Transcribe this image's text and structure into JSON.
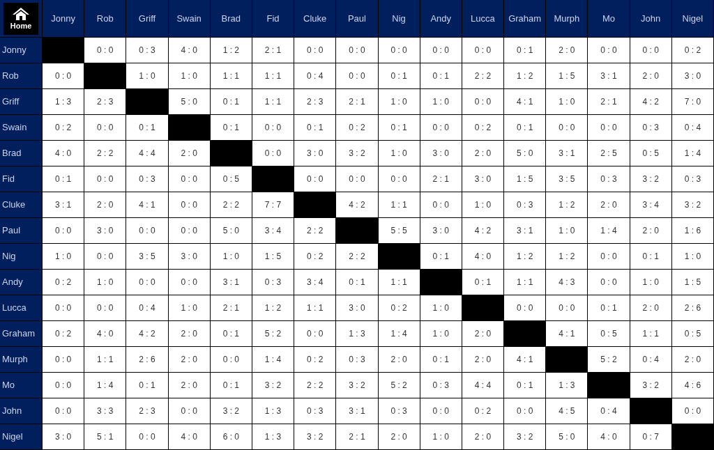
{
  "home_button": {
    "label": "Home"
  },
  "columns": [
    "Jonny",
    "Rob",
    "Griff",
    "Swain",
    "Brad",
    "Fid",
    "Cluke",
    "Paul",
    "Nig",
    "Andy",
    "Lucca",
    "Graham",
    "Murph",
    "Mo",
    "John",
    "Nigel"
  ],
  "rows": [
    {
      "name": "Jonny",
      "cells": [
        null,
        "0 : 0",
        "0 : 3",
        "4 : 0",
        "1 : 2",
        "2 : 1",
        "0 : 0",
        "0 : 0",
        "0 : 0",
        "0 : 0",
        "0 : 0",
        "0 : 1",
        "2 : 0",
        "0 : 0",
        "0 : 0",
        "0 : 2"
      ]
    },
    {
      "name": "Rob",
      "cells": [
        "0 : 0",
        null,
        "1 : 0",
        "1 : 0",
        "1 : 1",
        "1 : 1",
        "0 : 4",
        "0 : 0",
        "0 : 1",
        "0 : 1",
        "2 : 2",
        "1 : 2",
        "1 : 5",
        "3 : 1",
        "2 : 0",
        "3 : 0"
      ]
    },
    {
      "name": "Griff",
      "cells": [
        "1 : 3",
        "2 : 3",
        null,
        "5 : 0",
        "0 : 1",
        "1 : 1",
        "2 : 3",
        "2 : 1",
        "1 : 0",
        "1 : 0",
        "0 : 0",
        "4 : 1",
        "1 : 0",
        "2 : 1",
        "4 : 2",
        "7 : 0"
      ]
    },
    {
      "name": "Swain",
      "cells": [
        "0 : 2",
        "0 : 0",
        "0 : 1",
        null,
        "0 : 1",
        "0 : 0",
        "0 : 1",
        "0 : 2",
        "0 : 1",
        "0 : 0",
        "0 : 2",
        "0 : 1",
        "0 : 0",
        "0 : 0",
        "0 : 3",
        "0 : 4"
      ]
    },
    {
      "name": "Brad",
      "cells": [
        "4 : 0",
        "2 : 2",
        "4 : 4",
        "2 : 0",
        null,
        "0 : 0",
        "3 : 0",
        "3 : 2",
        "1 : 0",
        "3 : 0",
        "2 : 0",
        "5 : 0",
        "3 : 1",
        "2 : 5",
        "0 : 5",
        "1 : 4"
      ]
    },
    {
      "name": "Fid",
      "cells": [
        "0 : 1",
        "0 : 0",
        "0 : 3",
        "0 : 0",
        "0 : 5",
        null,
        "0 : 0",
        "0 : 0",
        "0 : 0",
        "2 : 1",
        "3 : 0",
        "1 : 5",
        "3 : 5",
        "0 : 3",
        "3 : 2",
        "0 : 3"
      ]
    },
    {
      "name": "Cluke",
      "cells": [
        "3 : 1",
        "2 : 0",
        "4 : 1",
        "0 : 0",
        "2 : 2",
        "7 : 7",
        null,
        "4 : 2",
        "1 : 1",
        "0 : 0",
        "1 : 0",
        "0 : 3",
        "1 : 2",
        "2 : 0",
        "3 : 4",
        "3 : 2"
      ]
    },
    {
      "name": "Paul",
      "cells": [
        "0 : 0",
        "3 : 0",
        "0 : 0",
        "0 : 0",
        "5 : 0",
        "3 : 4",
        "2 : 2",
        null,
        "5 : 5",
        "3 : 0",
        "4 : 2",
        "3 : 1",
        "1 : 0",
        "1 : 4",
        "2 : 0",
        "1 : 6"
      ]
    },
    {
      "name": "Nig",
      "cells": [
        "1 : 0",
        "0 : 0",
        "3 : 5",
        "3 : 0",
        "1 : 0",
        "1 : 5",
        "0 : 2",
        "2 : 2",
        null,
        "0 : 1",
        "4 : 0",
        "1 : 2",
        "1 : 2",
        "0 : 0",
        "0 : 1",
        "1 : 0"
      ]
    },
    {
      "name": "Andy",
      "cells": [
        "0 : 2",
        "1 : 0",
        "0 : 0",
        "0 : 0",
        "3 : 1",
        "0 : 3",
        "3 : 4",
        "0 : 1",
        "1 : 1",
        null,
        "0 : 1",
        "1 : 1",
        "4 : 3",
        "0 : 0",
        "1 : 0",
        "1 : 5"
      ]
    },
    {
      "name": "Lucca",
      "cells": [
        "0 : 0",
        "0 : 0",
        "0 : 4",
        "1 : 0",
        "2 : 1",
        "1 : 2",
        "1 : 1",
        "3 : 0",
        "0 : 2",
        "1 : 0",
        null,
        "0 : 0",
        "0 : 0",
        "0 : 1",
        "2 : 0",
        "2 : 6"
      ]
    },
    {
      "name": "Graham",
      "cells": [
        "0 : 2",
        "4 : 0",
        "4 : 2",
        "2 : 0",
        "0 : 1",
        "5 : 2",
        "0 : 0",
        "1 : 3",
        "1 : 4",
        "1 : 0",
        "2 : 0",
        null,
        "4 : 1",
        "0 : 5",
        "1 : 1",
        "0 : 5"
      ]
    },
    {
      "name": "Murph",
      "cells": [
        "0 : 0",
        "1 : 1",
        "2 : 6",
        "2 : 0",
        "0 : 0",
        "1 : 4",
        "0 : 2",
        "0 : 3",
        "2 : 0",
        "0 : 1",
        "2 : 0",
        "4 : 1",
        null,
        "5 : 2",
        "0 : 4",
        "2 : 0"
      ]
    },
    {
      "name": "Mo",
      "cells": [
        "0 : 0",
        "1 : 4",
        "0 : 1",
        "2 : 0",
        "0 : 1",
        "3 : 2",
        "2 : 2",
        "3 : 2",
        "5 : 2",
        "0 : 3",
        "4 : 4",
        "0 : 1",
        "1 : 3",
        null,
        "3 : 2",
        "4 : 6"
      ]
    },
    {
      "name": "John",
      "cells": [
        "0 : 0",
        "3 : 3",
        "2 : 3",
        "0 : 0",
        "3 : 2",
        "1 : 3",
        "0 : 3",
        "3 : 1",
        "0 : 3",
        "0 : 0",
        "0 : 2",
        "0 : 0",
        "4 : 5",
        "0 : 4",
        null,
        "0 : 0"
      ]
    },
    {
      "name": "Nigel",
      "cells": [
        "3 : 0",
        "5 : 1",
        "0 : 0",
        "4 : 0",
        "6 : 0",
        "1 : 3",
        "3 : 2",
        "2 : 1",
        "2 : 0",
        "1 : 0",
        "2 : 0",
        "3 : 2",
        "5 : 0",
        "4 : 0",
        "0 : 7",
        null
      ]
    }
  ]
}
